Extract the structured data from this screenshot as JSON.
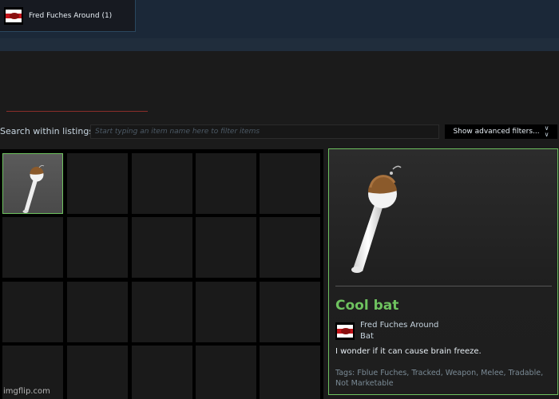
{
  "header": {
    "game_tab_label": "Fred Fuches Around",
    "game_tab_count": "(1)",
    "game_icon": "game-flag-icon"
  },
  "search": {
    "label": "Search within listings:",
    "placeholder": "Start typing an item name here to filter items",
    "value": "",
    "advanced_button": "Show advanced filters...",
    "advanced_icon": "double-chevron-down-icon"
  },
  "inventory": {
    "columns": 5,
    "rows_visible": 4,
    "selected_index": 0,
    "items": [
      {
        "name": "Cool bat",
        "icon": "bat-icon"
      }
    ]
  },
  "detail": {
    "item_name": "Cool bat",
    "game_name": "Fred Fuches Around",
    "item_type": "Bat",
    "description": "I wonder if it can cause brain freeze.",
    "tags": "Tags: Fblue Fuches, Tracked, Weapon, Melee, Tradable, Not Marketable"
  },
  "watermark": "imgflip.com",
  "colors": {
    "accent_green": "#6ec25f",
    "top_bar": "#1b2838",
    "panel_bg": "#1b1b1b",
    "divider_red": "#8b2e2a"
  }
}
